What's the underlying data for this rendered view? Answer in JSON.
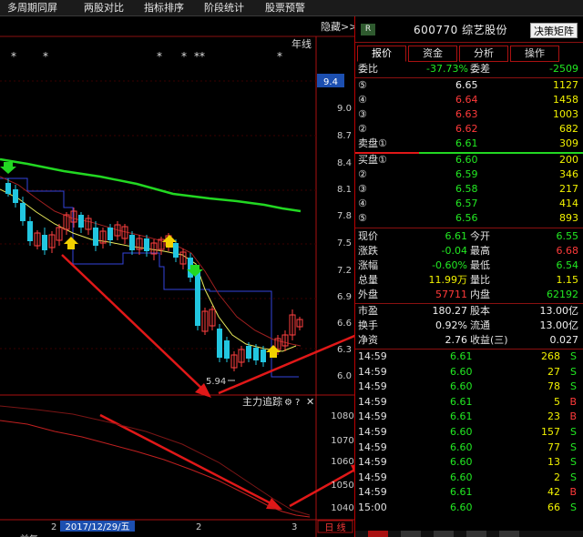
{
  "toolbar": [
    {
      "label": "多周期同屏"
    },
    {
      "label": "两股对比"
    },
    {
      "label": "指标排序"
    },
    {
      "label": "阶段统计"
    },
    {
      "label": "股票预警"
    }
  ],
  "chart": {
    "hide_label": "隐藏>>",
    "period_label": "年线",
    "price_ticks": [
      "9.4",
      "9.0",
      "8.7",
      "8.4",
      "8.1",
      "7.8",
      "7.5",
      "7.2",
      "6.9",
      "6.6",
      "6.3",
      "6.0"
    ],
    "current_price_tag": "9.4",
    "low_price_label": "5.94",
    "indicator_name": "主力追踪",
    "indicator_ticks": [
      "1080",
      "1070",
      "1060",
      "1050",
      "1040"
    ],
    "date_tooltip": "2017/12/29/五",
    "xaxis_labels": [
      "2",
      "2",
      "3"
    ],
    "day_tag": "日 线",
    "bottom_tab": "前复",
    "markers": "*   *                  *    *  **           *"
  },
  "stock": {
    "badge": "R",
    "code": "600770",
    "name": "综艺股份",
    "decision_button": "决策矩阵",
    "tabs": [
      "报价",
      "资金",
      "分析",
      "操作"
    ]
  },
  "weibi": {
    "label1": "委比",
    "value1": "-37.73%",
    "label2": "委差",
    "value2": "-2509"
  },
  "sell_orders": [
    {
      "label": "⑤",
      "price": "6.65",
      "volume": "1127"
    },
    {
      "label": "④",
      "price": "6.64",
      "volume": "1458"
    },
    {
      "label": "③",
      "price": "6.63",
      "volume": "1003"
    },
    {
      "label": "②",
      "price": "6.62",
      "volume": "682"
    },
    {
      "label": "卖盘①",
      "price": "6.61",
      "volume": "309"
    }
  ],
  "buy_orders": [
    {
      "label": "买盘①",
      "price": "6.60",
      "volume": "200"
    },
    {
      "label": "②",
      "price": "6.59",
      "volume": "346"
    },
    {
      "label": "③",
      "price": "6.58",
      "volume": "217"
    },
    {
      "label": "④",
      "price": "6.57",
      "volume": "414"
    },
    {
      "label": "⑤",
      "price": "6.56",
      "volume": "893"
    }
  ],
  "quote_stats": [
    {
      "l1": "现价",
      "v1": "6.61",
      "l2": "今开",
      "v2": "6.55"
    },
    {
      "l1": "涨跌",
      "v1": "-0.04",
      "l2": "最高",
      "v2": "6.68"
    },
    {
      "l1": "涨幅",
      "v1": "-0.60%",
      "l2": "最低",
      "v2": "6.54"
    },
    {
      "l1": "总量",
      "v1": "11.99万",
      "l2": "量比",
      "v2": "1.15"
    },
    {
      "l1": "外盘",
      "v1": "57711",
      "l2": "内盘",
      "v2": "62192"
    }
  ],
  "fundamentals": [
    {
      "l1": "市盈",
      "v1": "180.27",
      "l2": "股本",
      "v2": "13.00亿"
    },
    {
      "l1": "换手",
      "v1": "0.92%",
      "l2": "流通",
      "v2": "13.00亿"
    },
    {
      "l1": "净资",
      "v1": "2.76",
      "l2": "收益(三)",
      "v2": "0.027"
    }
  ],
  "ticks": [
    {
      "time": "14:59",
      "price": "6.61",
      "volume": "268",
      "side": "S"
    },
    {
      "time": "14:59",
      "price": "6.60",
      "volume": "27",
      "side": "S"
    },
    {
      "time": "14:59",
      "price": "6.60",
      "volume": "78",
      "side": "S"
    },
    {
      "time": "14:59",
      "price": "6.61",
      "volume": "5",
      "side": "B"
    },
    {
      "time": "14:59",
      "price": "6.61",
      "volume": "23",
      "side": "B"
    },
    {
      "time": "14:59",
      "price": "6.60",
      "volume": "157",
      "side": "S"
    },
    {
      "time": "14:59",
      "price": "6.60",
      "volume": "77",
      "side": "S"
    },
    {
      "time": "14:59",
      "price": "6.60",
      "volume": "13",
      "side": "S"
    },
    {
      "time": "14:59",
      "price": "6.60",
      "volume": "2",
      "side": "S"
    },
    {
      "time": "14:59",
      "price": "6.61",
      "volume": "42",
      "side": "B"
    },
    {
      "time": "15:00",
      "price": "6.60",
      "volume": "66",
      "side": "S"
    }
  ],
  "colors": {
    "up": "#ff3a3a",
    "down": "#22e822",
    "neutral": "#f0f0f0",
    "border": "#aa1111"
  }
}
